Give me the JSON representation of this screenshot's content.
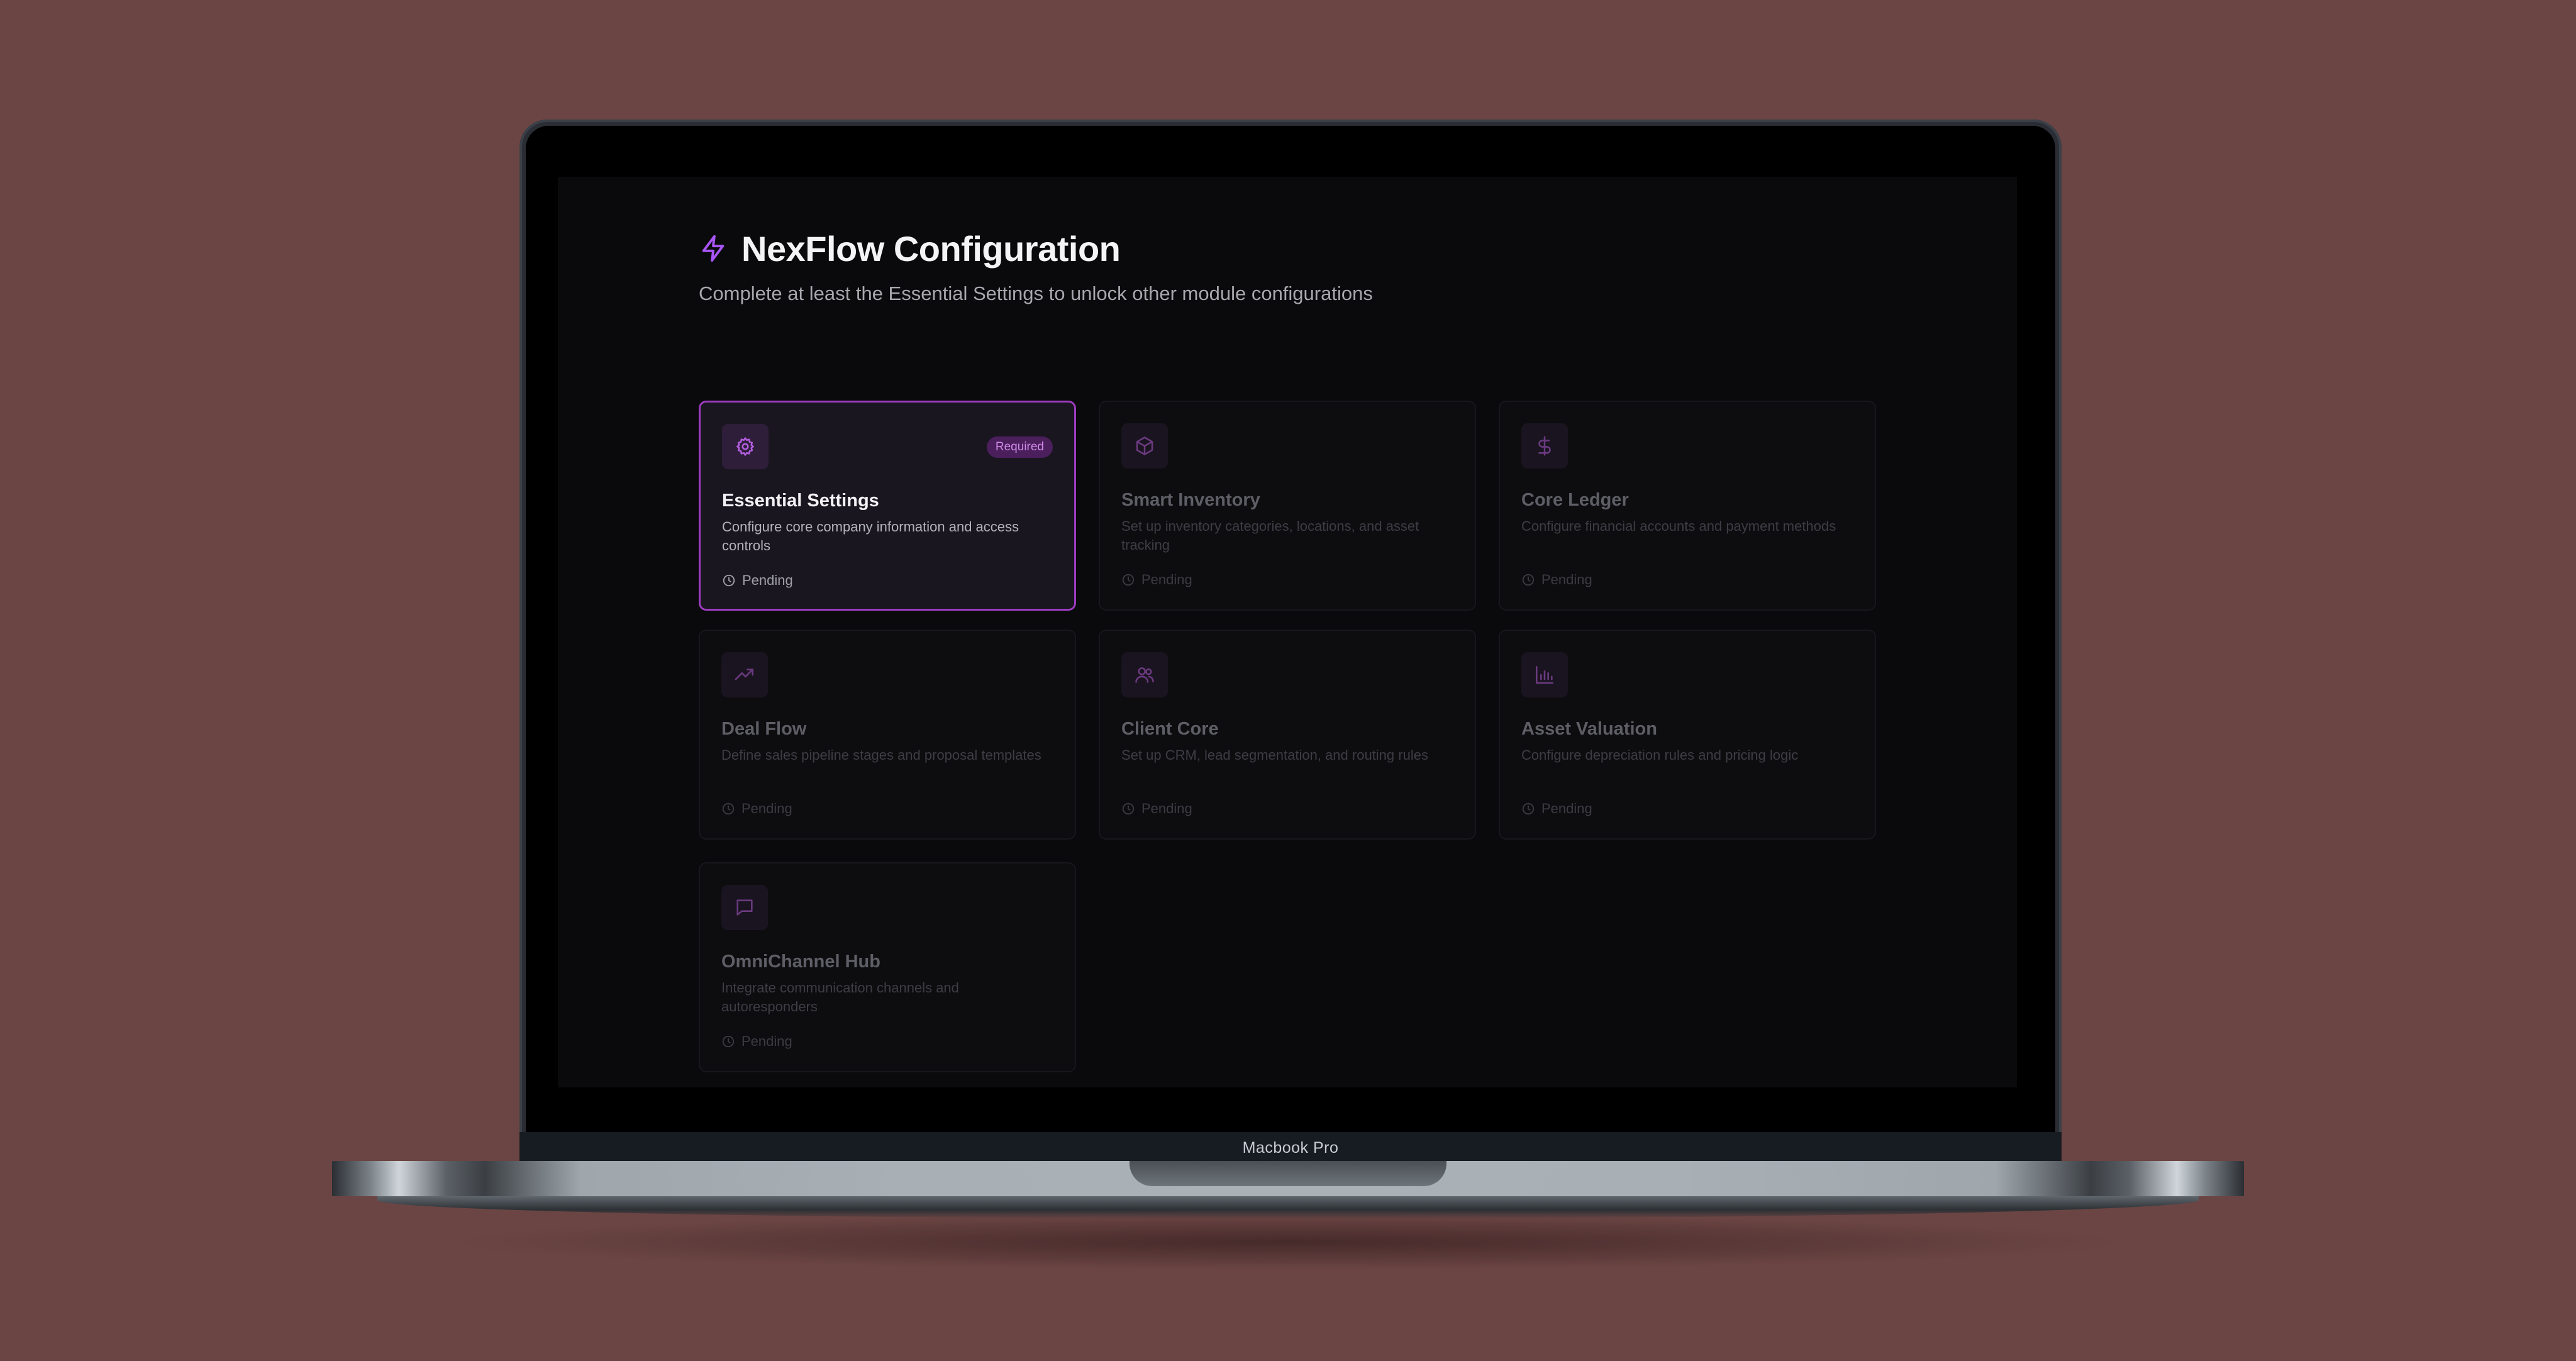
{
  "device": {
    "label": "Macbook Pro"
  },
  "header": {
    "title": "NexFlow Configuration",
    "subtitle": "Complete at least the Essential Settings to unlock other module configurations",
    "icon": "bolt-icon"
  },
  "colors": {
    "accent": "#a855f7",
    "accent_border": "#9d3bc0",
    "badge_bg": "#4a1f5c",
    "badge_text": "#d18ae8",
    "screen_bg": "#0a0a0c",
    "backdrop": "#6b4544"
  },
  "modules": [
    {
      "title": "Essential Settings",
      "description": "Configure core company information and access controls",
      "status": "Pending",
      "badge": "Required",
      "icon": "gear-icon",
      "active": true
    },
    {
      "title": "Smart Inventory",
      "description": "Set up inventory categories, locations, and asset tracking",
      "status": "Pending",
      "icon": "box-icon",
      "active": false
    },
    {
      "title": "Core Ledger",
      "description": "Configure financial accounts and payment methods",
      "status": "Pending",
      "icon": "dollar-icon",
      "active": false
    },
    {
      "title": "Deal Flow",
      "description": "Define sales pipeline stages and proposal templates",
      "status": "Pending",
      "icon": "trending-up-icon",
      "active": false
    },
    {
      "title": "Client Core",
      "description": "Set up CRM, lead segmentation, and routing rules",
      "status": "Pending",
      "icon": "users-icon",
      "active": false
    },
    {
      "title": "Asset Valuation",
      "description": "Configure depreciation rules and pricing logic",
      "status": "Pending",
      "icon": "bar-chart-icon",
      "active": false
    },
    {
      "title": "OmniChannel Hub",
      "description": "Integrate communication channels and autoresponders",
      "status": "Pending",
      "icon": "message-icon",
      "active": false
    }
  ]
}
